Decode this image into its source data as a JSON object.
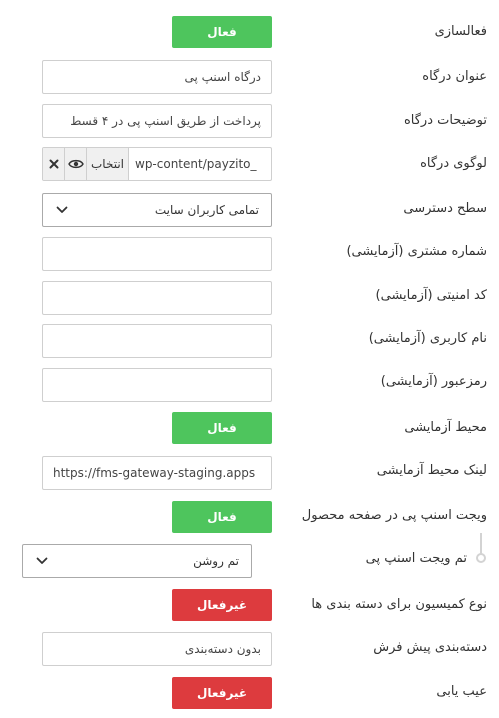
{
  "settings": {
    "activation": {
      "label": "فعالسازی",
      "state": "فعال"
    },
    "gateway_title": {
      "label": "عنوان درگاه",
      "value": "درگاه اسنپ پی"
    },
    "gateway_description": {
      "label": "توضیحات درگاه",
      "value": "پرداخت از طریق اسنپ پی در ۴ قسط"
    },
    "gateway_logo": {
      "label": "لوگوی درگاه",
      "value": "wp-content/payzito_",
      "pick_label": "انتخاب",
      "view_icon": "eye-icon",
      "clear_icon": "close-icon"
    },
    "access_level": {
      "label": "سطح دسترسی",
      "value": "تمامی کاربران سایت",
      "icon": "chevron-down-icon"
    },
    "customer_number": {
      "label": "شماره مشتری (آزمایشی)",
      "value": ""
    },
    "security_code": {
      "label": "کد امنیتی (آزمایشی)",
      "value": ""
    },
    "username": {
      "label": "نام کاربری (آزمایشی)",
      "value": ""
    },
    "password": {
      "label": "رمزعبور (آزمایشی)",
      "value": ""
    },
    "test_env": {
      "label": "محیط آزمایشی",
      "state": "فعال"
    },
    "test_env_link": {
      "label": "لینک محیط آزمایشی",
      "value": "https://fms-gateway-staging.apps"
    },
    "product_widget": {
      "label": "ویجت اسنپ پی در صفحه محصول",
      "state": "فعال"
    },
    "widget_theme": {
      "label": "تم ویجت اسنپ پی",
      "value": "تم روشن",
      "icon": "chevron-down-icon"
    },
    "commission_type": {
      "label": "نوع کمیسیون برای دسته بندی ها",
      "state": "غیرفعال"
    },
    "default_category": {
      "label": "دسته‌بندی پیش فرش",
      "value": "بدون دسته‌بندی"
    },
    "debug": {
      "label": "عیب یابی",
      "state": "غیرفعال"
    }
  },
  "colors": {
    "on": "#4ec55d",
    "off": "#dd3b3e"
  }
}
